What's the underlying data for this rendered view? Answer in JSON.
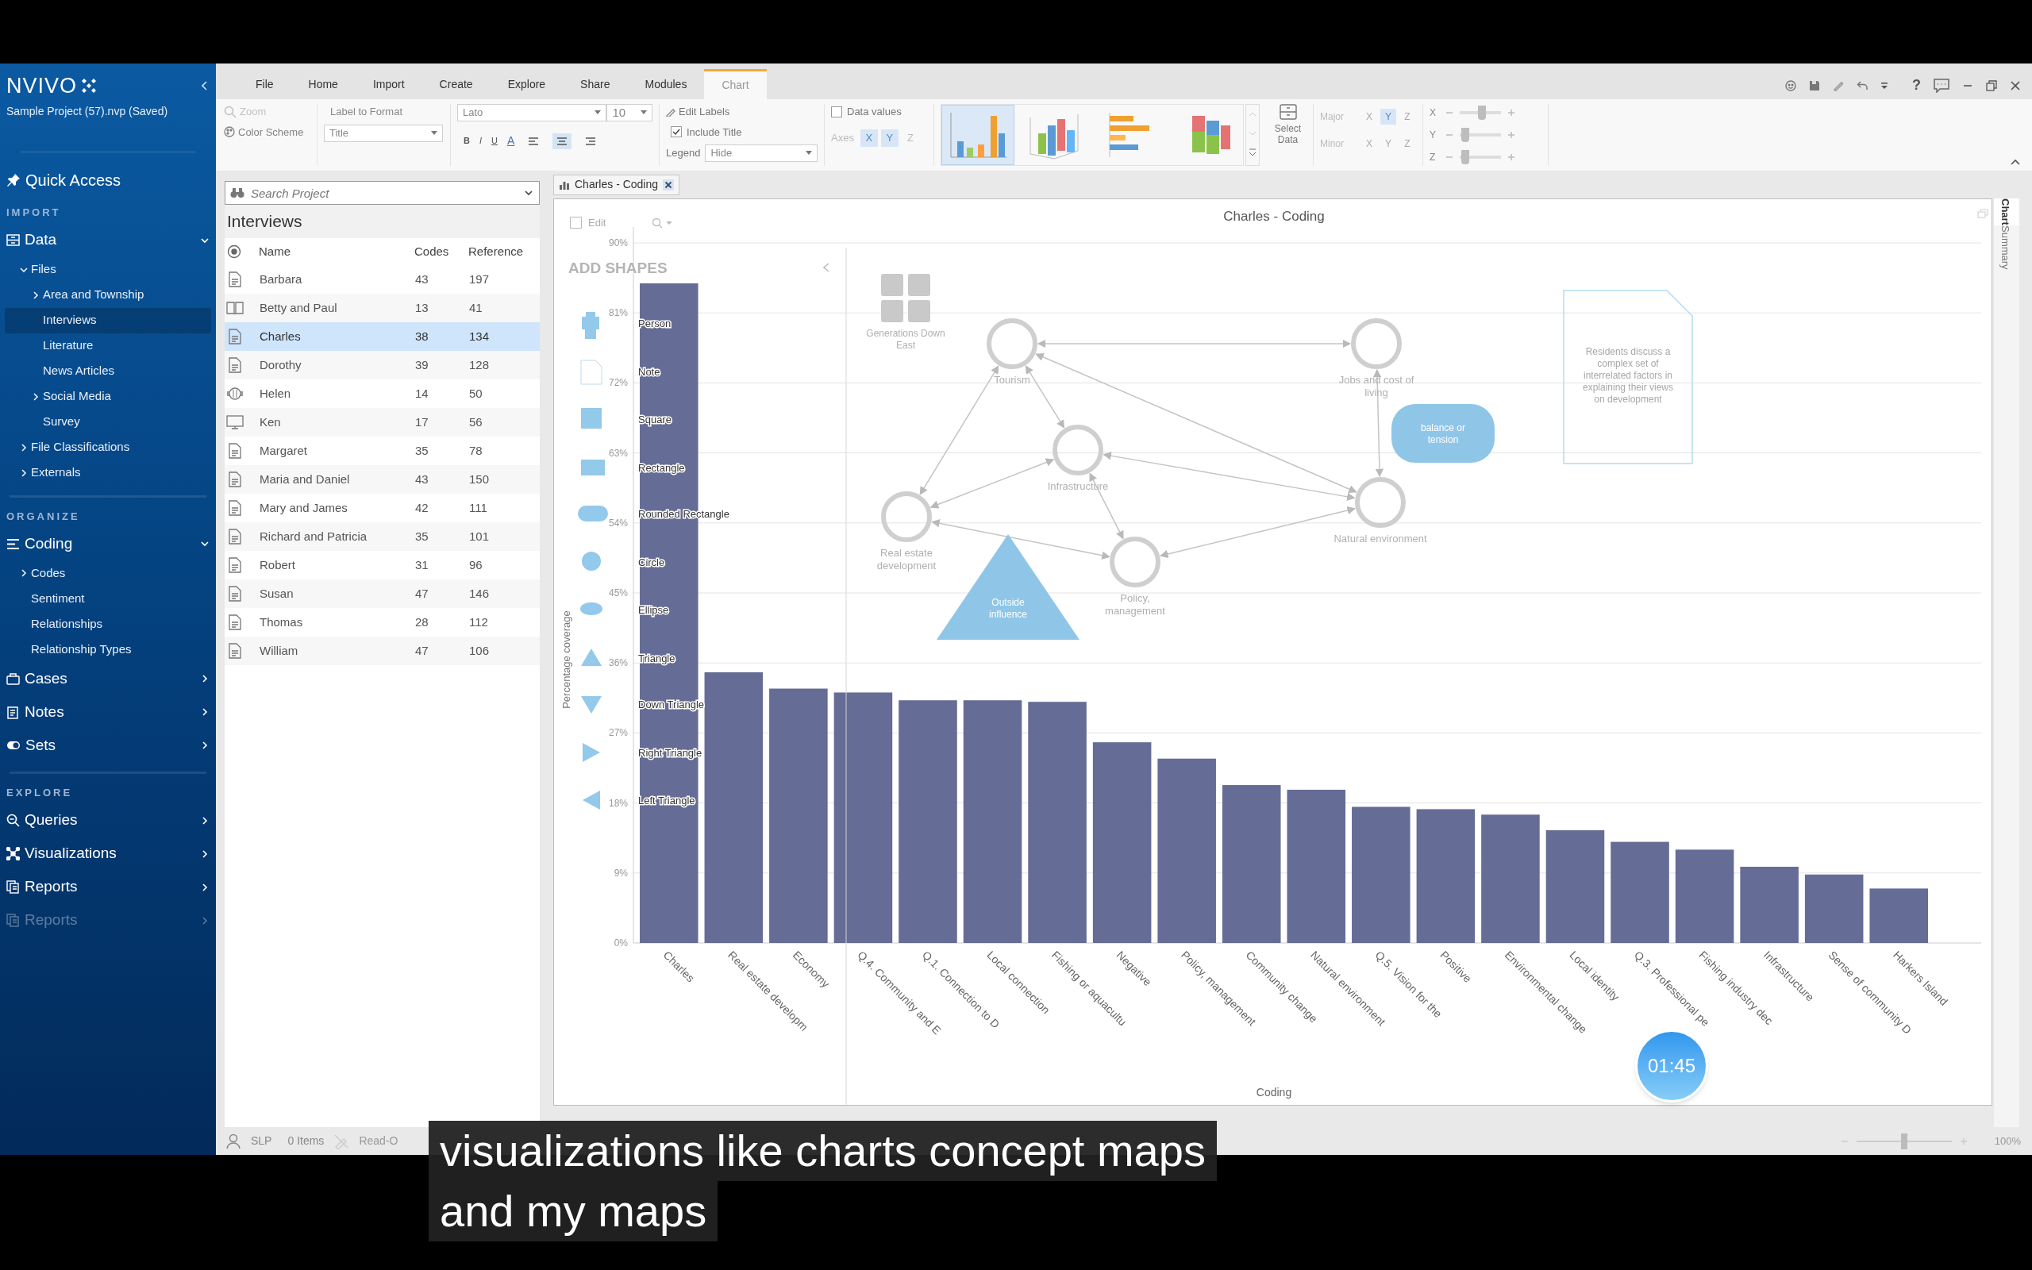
{
  "sidebar": {
    "logo": "NVIVO",
    "project": "Sample Project (57).nvp (Saved)",
    "quick_access": "Quick Access",
    "sections": [
      {
        "heading": "IMPORT",
        "groups": [
          {
            "label": "Data",
            "expanded": true,
            "disabled": false,
            "children": [
              {
                "label": "Files",
                "expanded": true,
                "selected": false,
                "children": [
                  {
                    "label": "Area and Township",
                    "expanded": false,
                    "selected": false
                  },
                  {
                    "label": "Interviews",
                    "selected": true
                  },
                  {
                    "label": "Literature",
                    "selected": false
                  },
                  {
                    "label": "News Articles",
                    "selected": false
                  },
                  {
                    "label": "Social Media",
                    "expanded": false,
                    "selected": false
                  },
                  {
                    "label": "Survey",
                    "selected": false
                  }
                ]
              },
              {
                "label": "File Classifications",
                "expanded": false,
                "selected": false
              },
              {
                "label": "Externals",
                "expanded": false,
                "selected": false
              }
            ]
          }
        ]
      },
      {
        "heading": "ORGANIZE",
        "groups": [
          {
            "label": "Coding",
            "expanded": true,
            "disabled": false,
            "children": [
              {
                "label": "Codes",
                "expanded": false,
                "selected": false
              },
              {
                "label": "Sentiment",
                "selected": false
              },
              {
                "label": "Relationships",
                "selected": false
              },
              {
                "label": "Relationship Types",
                "selected": false
              }
            ]
          },
          {
            "label": "Cases",
            "expanded": false,
            "disabled": false
          },
          {
            "label": "Notes",
            "expanded": false,
            "disabled": false
          },
          {
            "label": "Sets",
            "expanded": false,
            "disabled": false
          }
        ]
      },
      {
        "heading": "EXPLORE",
        "groups": [
          {
            "label": "Queries",
            "expanded": false,
            "disabled": false
          },
          {
            "label": "Visualizations",
            "expanded": false,
            "disabled": false
          },
          {
            "label": "Reports",
            "expanded": false,
            "disabled": false
          },
          {
            "label": "Reports",
            "expanded": false,
            "disabled": true
          }
        ]
      }
    ]
  },
  "ribbon": {
    "tabs": [
      {
        "label": "File",
        "selected": false
      },
      {
        "label": "Home",
        "selected": false
      },
      {
        "label": "Import",
        "selected": false
      },
      {
        "label": "Create",
        "selected": false
      },
      {
        "label": "Explore",
        "selected": false
      },
      {
        "label": "Share",
        "selected": false
      },
      {
        "label": "Modules",
        "selected": false
      },
      {
        "label": "Chart",
        "selected": true
      }
    ],
    "zoom": "Zoom",
    "color_scheme": "Color Scheme",
    "label_to_format": "Label to Format",
    "label_select": "Title",
    "font": "Lato",
    "font_size": "10",
    "format_buttons": [
      "B",
      "I",
      "U",
      "A"
    ],
    "alignment": [
      {
        "selected": false
      },
      {
        "selected": true
      },
      {
        "selected": false
      }
    ],
    "edit_labels": "Edit Labels",
    "include_title": {
      "label": "Include Title",
      "checked": true
    },
    "legend": {
      "label": "Legend",
      "value": "Hide"
    },
    "data_values": {
      "label": "Data values",
      "checked": false
    },
    "axes": {
      "label": "Axes",
      "options": [
        {
          "label": "X",
          "selected": true
        },
        {
          "label": "Y",
          "selected": true
        },
        {
          "label": "Z",
          "selected": false
        }
      ]
    },
    "chart_types": [
      {
        "kind": "column",
        "selected": true
      },
      {
        "kind": "column-3d",
        "selected": false
      },
      {
        "kind": "bar",
        "selected": false
      },
      {
        "kind": "stacked-3d",
        "selected": false
      }
    ],
    "select_data": "Select Data",
    "gridlines": [
      {
        "label": "Major",
        "options": [
          {
            "label": "X",
            "selected": false
          },
          {
            "label": "Y",
            "selected": true
          },
          {
            "label": "Z",
            "selected": false
          }
        ]
      },
      {
        "label": "Minor",
        "options": [
          {
            "label": "X",
            "selected": false
          },
          {
            "label": "Y",
            "selected": false
          },
          {
            "label": "Z",
            "selected": false
          }
        ]
      }
    ],
    "rotation": [
      {
        "axis": "X",
        "level": 0.55
      },
      {
        "axis": "Y",
        "level": 0.05
      },
      {
        "axis": "Z",
        "level": 0.05
      }
    ],
    "help": "?"
  },
  "list_panel": {
    "search": {
      "placeholder": "Search Project"
    },
    "title": "Interviews",
    "columns": [
      "Name",
      "Codes",
      "Reference"
    ],
    "rows": [
      {
        "kind": "document",
        "name": "Barbara",
        "codes": "43",
        "references": "197",
        "selected": false
      },
      {
        "kind": "book",
        "name": "Betty and Paul",
        "codes": "13",
        "references": "41",
        "selected": false
      },
      {
        "kind": "document",
        "name": "Charles",
        "codes": "38",
        "references": "134",
        "selected": true
      },
      {
        "kind": "document",
        "name": "Dorothy",
        "codes": "39",
        "references": "128",
        "selected": false
      },
      {
        "kind": "audio",
        "name": "Helen",
        "codes": "14",
        "references": "50",
        "selected": false
      },
      {
        "kind": "video",
        "name": "Ken",
        "codes": "17",
        "references": "56",
        "selected": false
      },
      {
        "kind": "document",
        "name": "Margaret",
        "codes": "35",
        "references": "78",
        "selected": false
      },
      {
        "kind": "document",
        "name": "Maria and Daniel",
        "codes": "43",
        "references": "150",
        "selected": false
      },
      {
        "kind": "document",
        "name": "Mary and James",
        "codes": "42",
        "references": "111",
        "selected": false
      },
      {
        "kind": "document",
        "name": "Richard and Patricia",
        "codes": "35",
        "references": "101",
        "selected": false
      },
      {
        "kind": "document",
        "name": "Robert",
        "codes": "31",
        "references": "96",
        "selected": false
      },
      {
        "kind": "document",
        "name": "Susan",
        "codes": "47",
        "references": "146",
        "selected": false
      },
      {
        "kind": "document",
        "name": "Thomas",
        "codes": "28",
        "references": "112",
        "selected": false
      },
      {
        "kind": "document",
        "name": "William",
        "codes": "47",
        "references": "106",
        "selected": false
      }
    ]
  },
  "document_tabs": [
    {
      "label": "Charles - Coding",
      "selected": true
    }
  ],
  "chart_view": {
    "edit": {
      "label": "Edit",
      "checked": false
    },
    "chart_data": {
      "type": "bar",
      "title": "Charles - Coding",
      "xlabel": "Coding",
      "ylabel": "Percentage coverage",
      "categories": [
        "Charles",
        "Real estate developm",
        "Economy",
        "Q.4. Community and E",
        "Q.1. Connection to D",
        "Local connection",
        "Fishing or aquacultu",
        "Negative",
        "Policy, management",
        "Community change",
        "Natural environment",
        "Q.5. Vision for the",
        "Positive",
        "Environmental change",
        "Local identity",
        "Q.3. Professional pe",
        "Fishing industry dec",
        "Infrastructure",
        "Sense of community D",
        "Harkers Island"
      ],
      "grid": true,
      "series": [
        {
          "color": "#656c95",
          "values": [
            84.8,
            34.8,
            32.7,
            32.2,
            31.2,
            31.2,
            31.0,
            25.8,
            23.7,
            20.3,
            19.7,
            17.5,
            17.2,
            16.5,
            14.5,
            13.0,
            12.0,
            9.8,
            8.8,
            7.0
          ]
        }
      ],
      "ylim": [
        0,
        90
      ],
      "yticks": [
        {
          "value": 0,
          "label": "0%"
        },
        {
          "value": 9,
          "label": "9%"
        },
        {
          "value": 18,
          "label": "18%"
        },
        {
          "value": 27,
          "label": "27%"
        },
        {
          "value": 36,
          "label": "36%"
        },
        {
          "value": 45,
          "label": "45%"
        },
        {
          "value": 54,
          "label": "54%"
        },
        {
          "value": 63,
          "label": "63%"
        },
        {
          "value": 72,
          "label": "72%"
        },
        {
          "value": 81,
          "label": "81%"
        },
        {
          "value": 90,
          "label": "90%"
        }
      ]
    },
    "side_tabs": [
      {
        "label": "Chart",
        "selected": true
      },
      {
        "label": "Summary",
        "selected": false
      }
    ],
    "timer": "01:45"
  },
  "concept_map": {
    "add_shapes": {
      "title": "ADD SHAPES",
      "shapes": [
        {
          "kind": "person",
          "label": "Person"
        },
        {
          "kind": "note",
          "label": "Note"
        },
        {
          "kind": "square",
          "label": "Square"
        },
        {
          "kind": "rectangle",
          "label": "Rectangle"
        },
        {
          "kind": "rounded-rectangle",
          "label": "Rounded Rectangle"
        },
        {
          "kind": "circle",
          "label": "Circle"
        },
        {
          "kind": "ellipse",
          "label": "Ellipse"
        },
        {
          "kind": "triangle",
          "label": "Triangle"
        },
        {
          "kind": "down-triangle",
          "label": "Down Triangle"
        },
        {
          "kind": "right-triangle",
          "label": "Right Triangle"
        },
        {
          "kind": "left-triangle",
          "label": "Left Triangle"
        }
      ]
    },
    "nodes": [
      {
        "kind": "image",
        "label": [
          "Generations Down",
          "East"
        ]
      },
      {
        "kind": "circle",
        "label": [
          "Tourism"
        ]
      },
      {
        "kind": "circle",
        "label": [
          "Jobs and cost of",
          "living"
        ]
      },
      {
        "kind": "circle",
        "label": [
          "Infrastructure"
        ]
      },
      {
        "kind": "circle",
        "label": [
          "Real estate",
          "development"
        ]
      },
      {
        "kind": "circle",
        "label": [
          "Policy,",
          "management"
        ]
      },
      {
        "kind": "circle",
        "label": [
          "Natural environment"
        ]
      },
      {
        "kind": "triangle",
        "label": [
          "Outside",
          "influence"
        ]
      },
      {
        "kind": "rounded",
        "label": [
          "balance or",
          "tension"
        ]
      },
      {
        "kind": "note",
        "label": [
          "Residents discuss a",
          "complex set of",
          "interrelated factors in",
          "explaining their views",
          "on development"
        ]
      }
    ]
  },
  "status_bar": {
    "user": "SLP",
    "items": "0 Items",
    "mode": "Read-O",
    "zoom": "100%",
    "zoom_slider": {
      "level": 0.5
    }
  },
  "subtitle": {
    "lines": [
      "visualizations like charts concept maps",
      "and my maps"
    ]
  }
}
